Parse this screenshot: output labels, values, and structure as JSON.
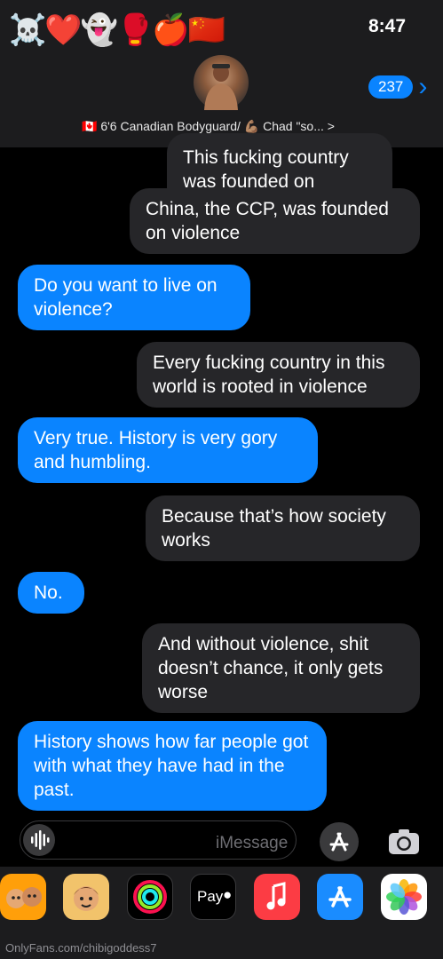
{
  "status": {
    "time": "8:47"
  },
  "header": {
    "emoji_row": "☠️❤️👻🥊🍎🇨🇳",
    "unread_badge": "237",
    "contact_name": "🇨🇦 6'6 Canadian Bodyguard/ 💪🏽 Chad \"so... >"
  },
  "messages": [
    {
      "direction": "incoming",
      "text": "This fucking country was founded on violence"
    },
    {
      "direction": "incoming",
      "text": "China, the CCP, was founded on violence"
    },
    {
      "direction": "outgoing",
      "text": "Do you want to live on violence?"
    },
    {
      "direction": "incoming",
      "text": "Every fucking country in this world is rooted in violence"
    },
    {
      "direction": "outgoing",
      "text": "Very true. History is very gory and humbling."
    },
    {
      "direction": "incoming",
      "text": "Because that’s how society works"
    },
    {
      "direction": "outgoing",
      "text": "No."
    },
    {
      "direction": "incoming",
      "text": "And without violence, shit doesn’t chance, it only gets worse"
    },
    {
      "direction": "outgoing",
      "text": "History shows how far people got with what they have had in the past."
    }
  ],
  "input": {
    "placeholder": "iMessage"
  },
  "drawer": {
    "apps": [
      {
        "name": "photos-app-icon",
        "label": ""
      },
      {
        "name": "app-store-app-icon",
        "label": ""
      },
      {
        "name": "music-app-icon",
        "label": ""
      },
      {
        "name": "apple-pay-app-icon",
        "label": "Pay"
      },
      {
        "name": "activity-app-icon",
        "label": ""
      },
      {
        "name": "memoji-app-icon",
        "label": ""
      },
      {
        "name": "memoji-stickers-app-icon",
        "label": ""
      }
    ]
  },
  "watermark": "OnlyFans.com/chibigoddess7"
}
